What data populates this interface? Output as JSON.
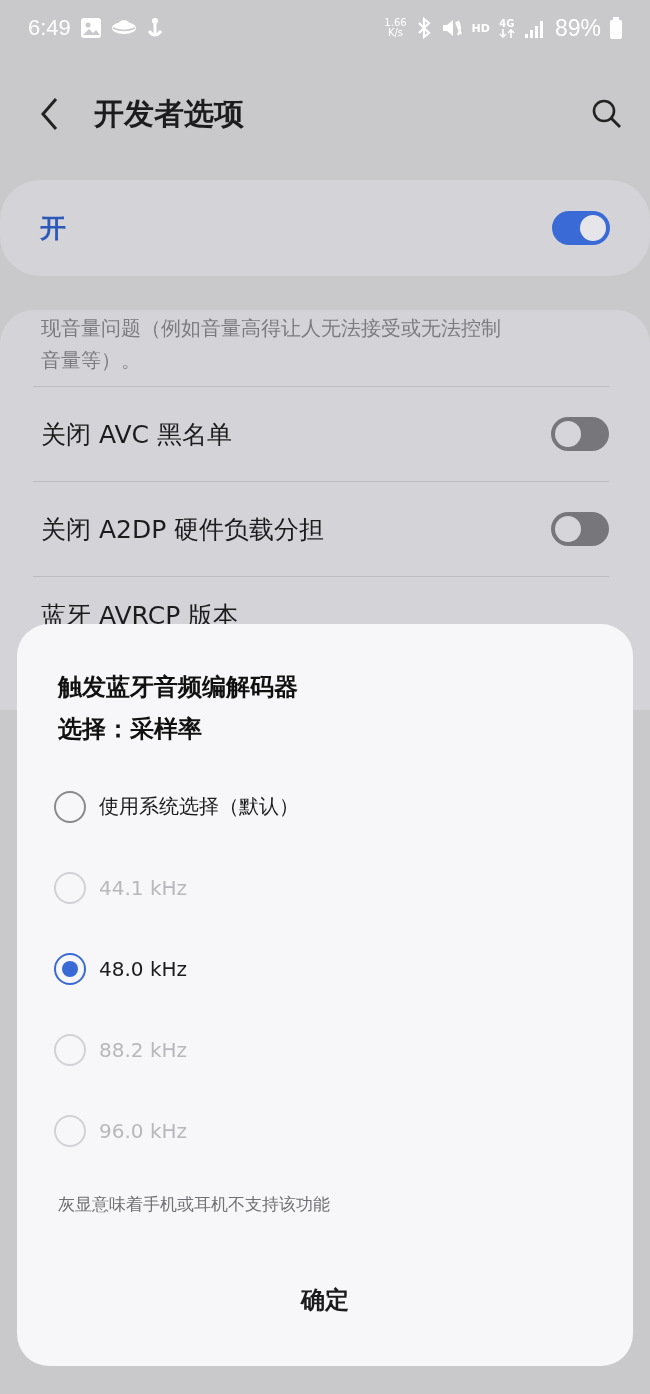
{
  "status_bar": {
    "time": "6:49",
    "speed": "1.66",
    "speed_unit": "K/s",
    "hd": "HD",
    "network": "4G",
    "battery": "89%"
  },
  "header": {
    "title": "开发者选项"
  },
  "master_switch": {
    "label": "开",
    "on": true
  },
  "settings": [
    {
      "kind": "text",
      "text": "现音量问题（例如音量高得让人无法接受或无法控制音量等）。"
    },
    {
      "kind": "toggle",
      "label": "关闭 AVC 黑名单",
      "on": false
    },
    {
      "kind": "toggle",
      "label": "关闭 A2DP 硬件负载分担",
      "on": false
    },
    {
      "kind": "item",
      "label": "蓝牙 AVRCP 版本"
    }
  ],
  "dialog": {
    "title_lines": [
      "触发蓝牙音频编解码器",
      "选择：采样率"
    ],
    "options": [
      {
        "label": "使用系统选择（默认）",
        "selected": false,
        "disabled": false
      },
      {
        "label": "44.1 kHz",
        "selected": false,
        "disabled": true
      },
      {
        "label": "48.0 kHz",
        "selected": true,
        "disabled": false
      },
      {
        "label": "88.2 kHz",
        "selected": false,
        "disabled": true
      },
      {
        "label": "96.0 kHz",
        "selected": false,
        "disabled": true
      }
    ],
    "note": "灰显意味着手机或耳机不支持该功能",
    "button": "确定"
  }
}
